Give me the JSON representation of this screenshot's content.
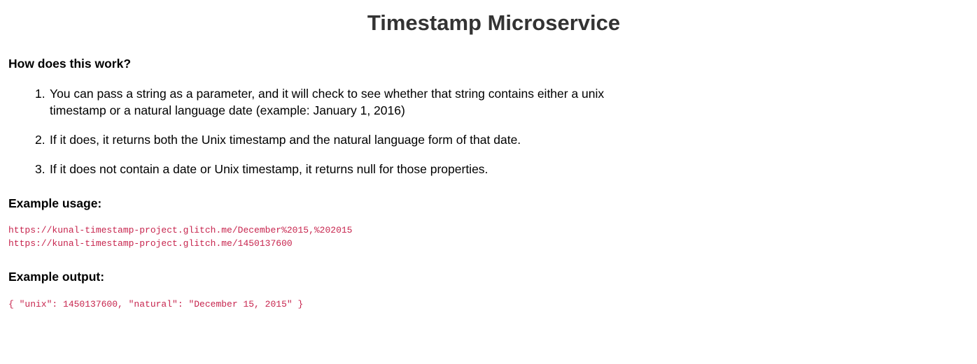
{
  "page": {
    "title": "Timestamp Microservice"
  },
  "how": {
    "heading": "How does this work?",
    "steps": [
      {
        "number": "1.",
        "line1": "You can pass a string as a parameter, and it will check to see whether that string contains either a unix",
        "line2": "timestamp or a natural language date (example: January 1, 2016)"
      },
      {
        "number": "2.",
        "line1": "If it does, it returns both the Unix timestamp and the natural language form of that date."
      },
      {
        "number": "3.",
        "line1": "If it does not contain a date or Unix timestamp, it returns null for those properties."
      }
    ]
  },
  "usage": {
    "heading": "Example usage:",
    "urls": [
      "https://kunal-timestamp-project.glitch.me/December%2015,%202015",
      "https://kunal-timestamp-project.glitch.me/1450137600"
    ]
  },
  "output": {
    "heading": "Example output:",
    "code": "{ \"unix\": 1450137600, \"natural\": \"December 15, 2015\" }"
  },
  "colors": {
    "title": "#333333",
    "text": "#000000",
    "code": "#c7254e",
    "background": "#ffffff"
  }
}
